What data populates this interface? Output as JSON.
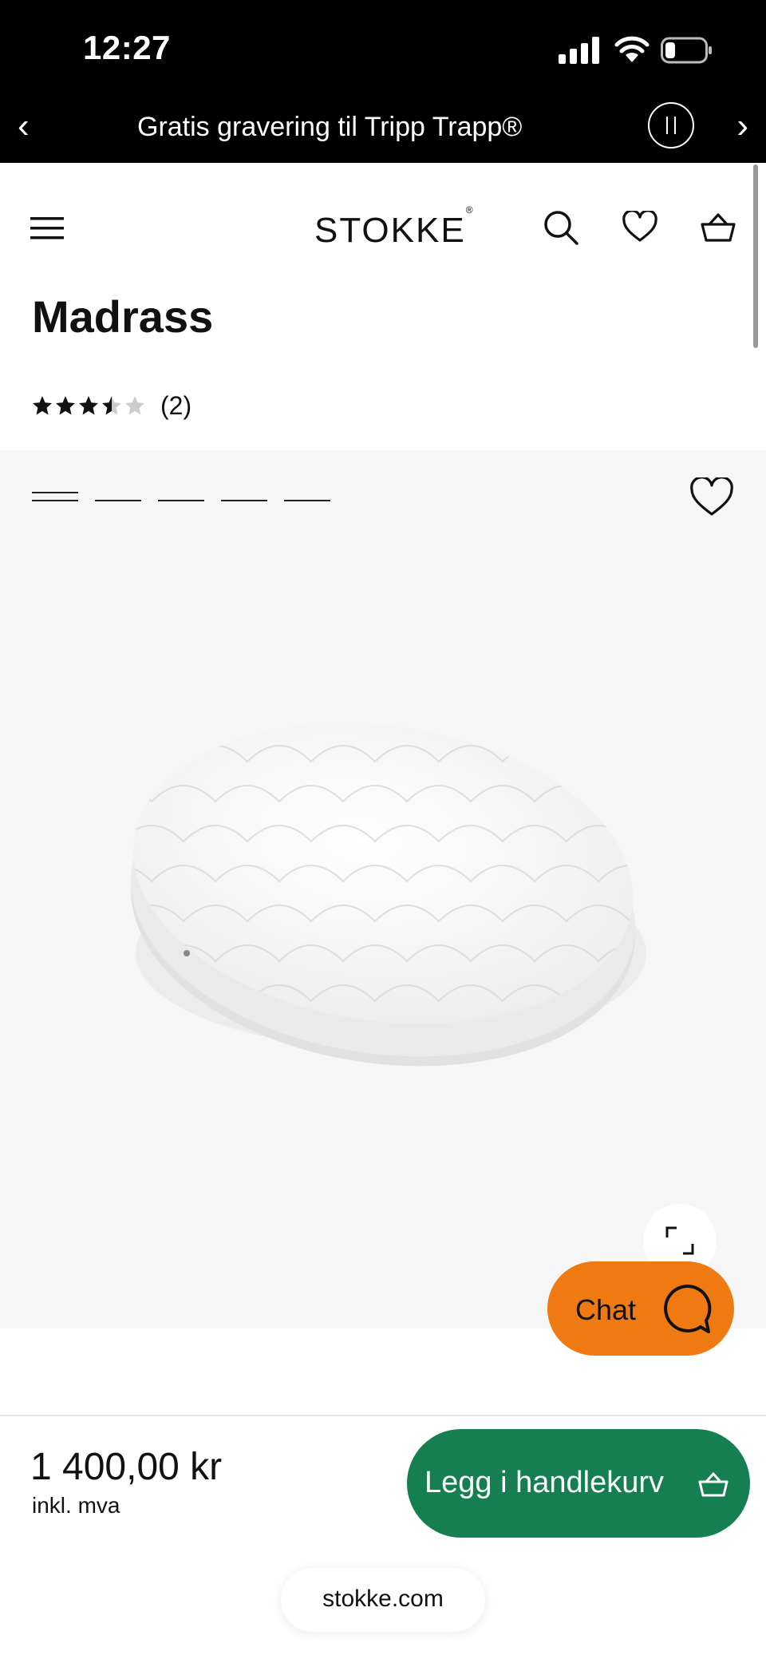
{
  "status_bar": {
    "time": "12:27",
    "icons": [
      "signal-icon",
      "wifi-icon",
      "battery-icon"
    ]
  },
  "promo": {
    "text": "Gratis gravering til Tripp Trapp®",
    "prev_glyph": "‹",
    "next_glyph": "›"
  },
  "header": {
    "logo": "STOKKE",
    "logo_mark": "®",
    "icons": [
      "menu-icon",
      "search-icon",
      "heart-icon",
      "basket-icon"
    ]
  },
  "product": {
    "title": "Madrass",
    "rating_value": 3.5,
    "rating_max": 5,
    "rating_count": "(2)",
    "image_count": 5,
    "active_image": 1,
    "price": "1 400,00 kr",
    "vat_note": "inkl. mva"
  },
  "chat": {
    "label": "Chat"
  },
  "cart": {
    "add_label": "Legg i handlekurv"
  },
  "browser": {
    "url": "stokke.com"
  },
  "colors": {
    "promo_bg": "#000000",
    "gallery_bg": "#f6f6f6",
    "chat_orange": "#f07a12",
    "cart_green": "#157f52",
    "star_filled": "#111111",
    "star_empty": "#cccccc"
  }
}
